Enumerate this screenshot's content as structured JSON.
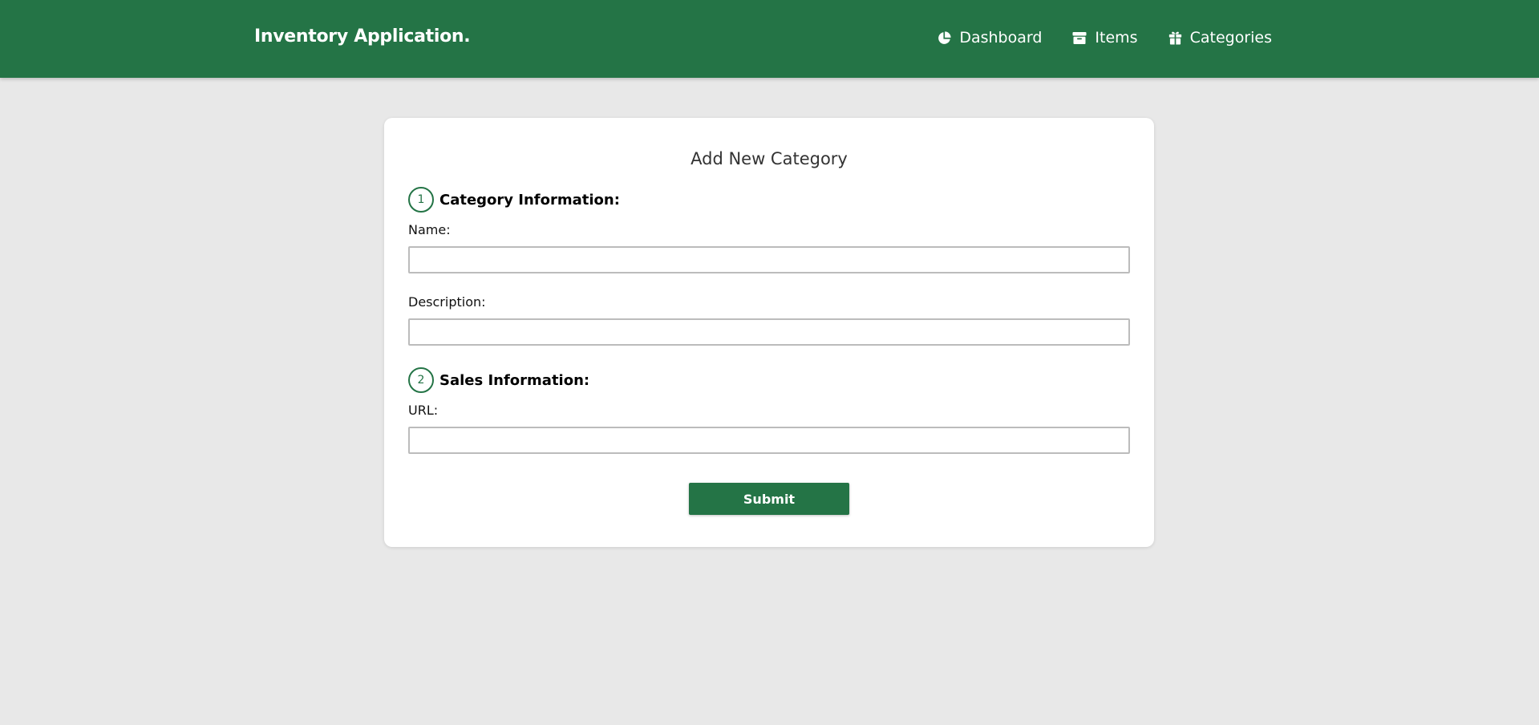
{
  "header": {
    "brand": "Inventory Application.",
    "nav": [
      {
        "label": "Dashboard",
        "icon": "pie-chart-icon"
      },
      {
        "label": "Items",
        "icon": "archive-box-icon"
      },
      {
        "label": "Categories",
        "icon": "gift-box-icon"
      }
    ]
  },
  "form": {
    "title": "Add New Category",
    "sections": [
      {
        "step": "1",
        "title": "Category Information:"
      },
      {
        "step": "2",
        "title": "Sales Information:"
      }
    ],
    "fields": {
      "name": {
        "label": "Name:",
        "value": "",
        "placeholder": ""
      },
      "description": {
        "label": "Description:",
        "value": "",
        "placeholder": ""
      },
      "url": {
        "label": "URL:",
        "value": "",
        "placeholder": ""
      }
    },
    "submit_label": "Submit"
  },
  "colors": {
    "brand_green": "#247446",
    "page_background": "#e8e8e8",
    "card_background": "#ffffff"
  }
}
